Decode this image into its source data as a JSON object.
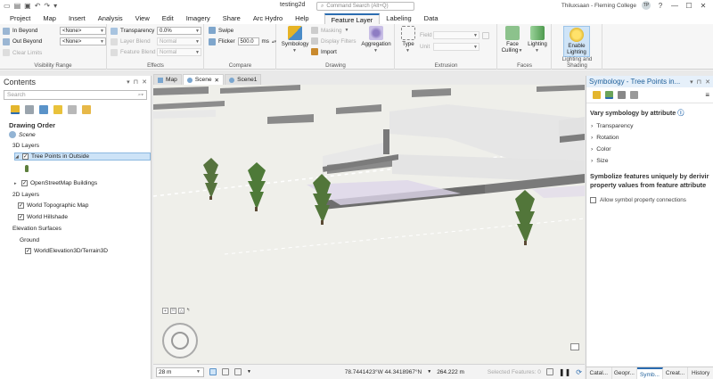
{
  "titlebar": {
    "document_title": "testing2d",
    "search_placeholder": "Command Search (Alt+Q)",
    "user_name": "Thiluxsaan - Fleming College",
    "user_initials": "TP",
    "window_buttons": [
      "?",
      "—",
      "☐",
      "✕"
    ]
  },
  "tabs": [
    {
      "label": "Project",
      "active": false
    },
    {
      "label": "Map",
      "active": false
    },
    {
      "label": "Insert",
      "active": false
    },
    {
      "label": "Analysis",
      "active": false
    },
    {
      "label": "View",
      "active": false
    },
    {
      "label": "Edit",
      "active": false
    },
    {
      "label": "Imagery",
      "active": false
    },
    {
      "label": "Share",
      "active": false
    },
    {
      "label": "Arc Hydro",
      "active": false
    },
    {
      "label": "Help",
      "active": false
    },
    {
      "label": "Feature Layer",
      "active": true
    },
    {
      "label": "Labeling",
      "active": false
    },
    {
      "label": "Data",
      "active": false
    }
  ],
  "ribbon": {
    "visibility": {
      "in_beyond_label": "In Beyond",
      "in_beyond_value": "<None>",
      "out_beyond_label": "Out Beyond",
      "out_beyond_value": "<None>",
      "clear_limits": "Clear Limits",
      "group_label": "Visibility Range"
    },
    "effects": {
      "transparency_label": "Transparency",
      "transparency_value": "0.0%",
      "layer_blend_label": "Layer Blend",
      "layer_blend_value": "Normal",
      "feature_blend_label": "Feature Blend",
      "feature_blend_value": "Normal",
      "group_label": "Effects"
    },
    "compare": {
      "swipe": "Swipe",
      "flicker_label": "Flicker",
      "flicker_value": "500.0",
      "flicker_unit": "ms",
      "group_label": "Compare"
    },
    "drawing": {
      "symbology": "Symbology",
      "masking": "Masking",
      "display_filters": "Display Filters",
      "import": "Import",
      "aggregation": "Aggregation",
      "group_label": "Drawing"
    },
    "extrusion": {
      "type": "Type",
      "field_label": "Field",
      "unit_label": "Unit",
      "group_label": "Extrusion"
    },
    "faces": {
      "face_culling": "Face Culling",
      "lighting": "Lighting",
      "group_label": "Faces"
    },
    "lighting_shading": {
      "enable_lighting": "Enable Lighting",
      "group_label": "Lighting and Shading"
    }
  },
  "contents": {
    "title": "Contents",
    "search_placeholder": "Search",
    "drawing_order_label": "Drawing Order",
    "scene_label": "Scene",
    "layers_3d_label": "3D Layers",
    "tree_points_label": "Tree Points in Outside",
    "osm_buildings_label": "OpenStreetMap Buildings",
    "layers_2d_label": "2D Layers",
    "topo_label": "World Topographic Map",
    "hillshade_label": "World Hillshade",
    "elevation_label": "Elevation Surfaces",
    "ground_label": "Ground",
    "terrain_label": "WorldElevation3D/Terrain3D"
  },
  "view": {
    "tabs": [
      {
        "label": "Map",
        "active": false
      },
      {
        "label": "Scene",
        "active": true
      },
      {
        "label": "Scene1",
        "active": false
      }
    ],
    "scale": "28 m",
    "coordinates": "78.7441423°W 44.3418967°N",
    "elevation": "264.222 m",
    "selected_features": "Selected Features: 0"
  },
  "symbology": {
    "title": "Symbology - Tree Points in...",
    "vary_label": "Vary symbology by attribute",
    "properties": [
      "Transparency",
      "Rotation",
      "Color",
      "Size"
    ],
    "message_line1": "Symbolize features uniquely by derivir",
    "message_line2": "property values from feature attribute",
    "allow_connections": "Allow symbol property connections",
    "bottom_tabs": [
      {
        "label": "Catal...",
        "active": false
      },
      {
        "label": "Geopr...",
        "active": false
      },
      {
        "label": "Symb...",
        "active": true
      },
      {
        "label": "Creat...",
        "active": false
      },
      {
        "label": "History",
        "active": false
      }
    ]
  },
  "colors": {
    "accent": "#2b6cb0",
    "selection": "#cde3f7",
    "tree": "#4f7a3a"
  }
}
